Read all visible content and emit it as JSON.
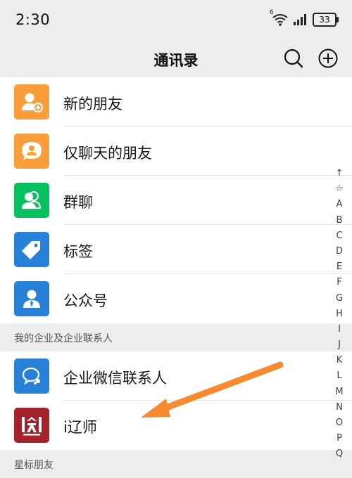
{
  "status_bar": {
    "time": "2:30",
    "battery": "33",
    "signal_label": "6"
  },
  "nav": {
    "title": "通讯录",
    "search_icon": "search-icon",
    "add_icon": "add-circle-icon"
  },
  "menu_items": [
    {
      "label": "新的朋友",
      "icon": "add-friend-icon",
      "color": "#FA9D3B"
    },
    {
      "label": "仅聊天的朋友",
      "icon": "chat-bubble-icon",
      "color": "#FA9D3B"
    },
    {
      "label": "群聊",
      "icon": "group-icon",
      "color": "#07C160"
    },
    {
      "label": "标签",
      "icon": "tag-icon",
      "color": "#2782D7"
    },
    {
      "label": "公众号",
      "icon": "official-account-icon",
      "color": "#2782D7"
    }
  ],
  "enterprise_section": {
    "title": "我的企业及企业联系人",
    "items": [
      {
        "label": "企业微信联系人",
        "icon": "wecom-icon",
        "color": "#2782D7"
      },
      {
        "label": "i辽师",
        "icon": "ilnnu-logo-icon",
        "color": "#A5212B"
      }
    ]
  },
  "next_section": {
    "title": "星标朋友"
  },
  "index_letters": [
    "↑",
    "☆",
    "A",
    "B",
    "C",
    "D",
    "E",
    "F",
    "G",
    "H",
    "I",
    "J",
    "K",
    "L",
    "M",
    "N",
    "O",
    "P",
    "Q"
  ],
  "annotation": {
    "arrow_color": "#F58A2E"
  }
}
